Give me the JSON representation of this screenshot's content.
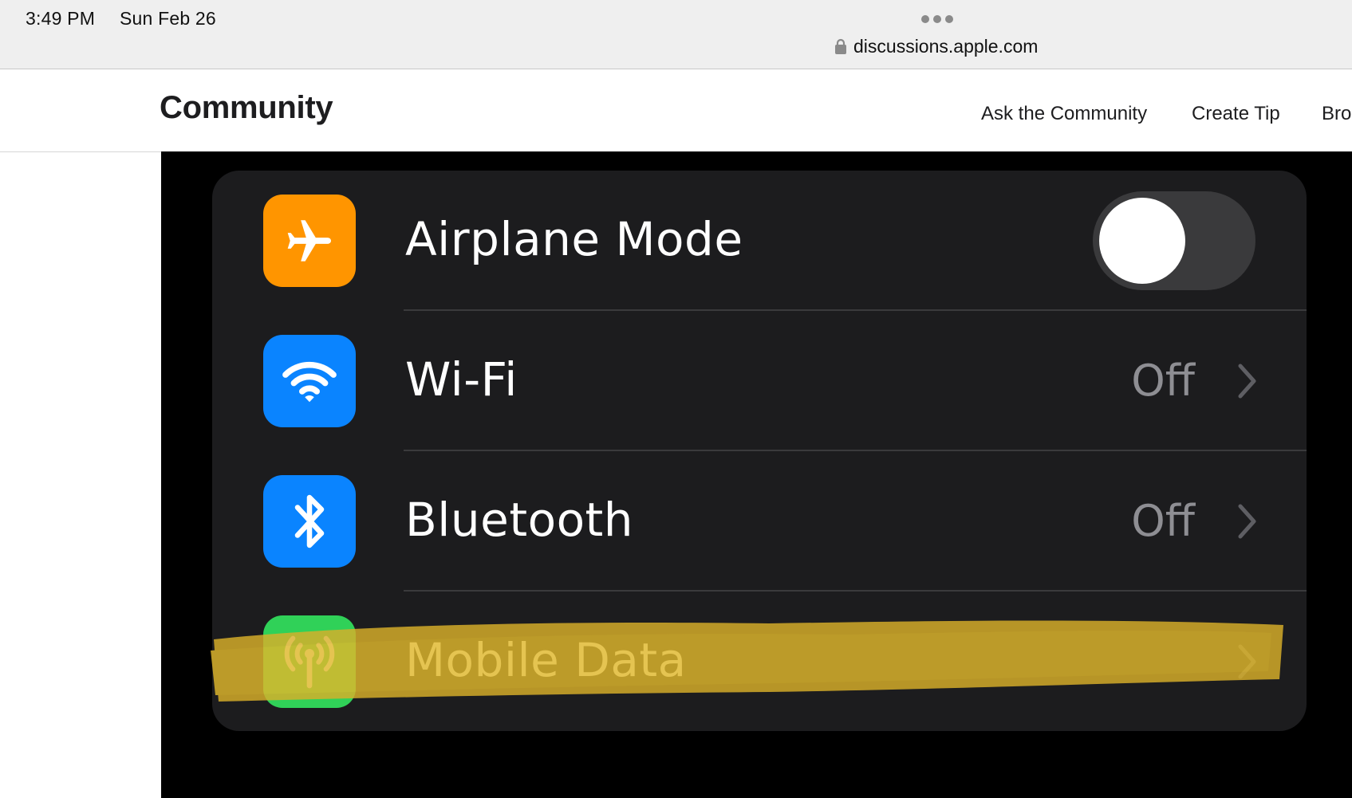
{
  "status_bar": {
    "time": "3:49 PM",
    "date": "Sun Feb 26",
    "url": "discussions.apple.com"
  },
  "community_header": {
    "title": "Community",
    "nav": [
      "Ask the Community",
      "Create Tip",
      "Bro"
    ]
  },
  "settings": {
    "rows": [
      {
        "label": "Airplane Mode",
        "icon": "airplane-icon",
        "icon_color": "#ff9500",
        "control": "toggle",
        "toggle_on": false
      },
      {
        "label": "Wi-Fi",
        "icon": "wifi-icon",
        "icon_color": "#0a84ff",
        "value": "Off"
      },
      {
        "label": "Bluetooth",
        "icon": "bluetooth-icon",
        "icon_color": "#0a84ff",
        "value": "Off"
      },
      {
        "label": "Mobile Data",
        "icon": "antenna-icon",
        "icon_color": "#30d158",
        "highlighted": true
      }
    ]
  },
  "colors": {
    "highlighter": "#d9b02a",
    "card_background": "#1c1c1e",
    "secondary_text": "#8e8e93"
  }
}
